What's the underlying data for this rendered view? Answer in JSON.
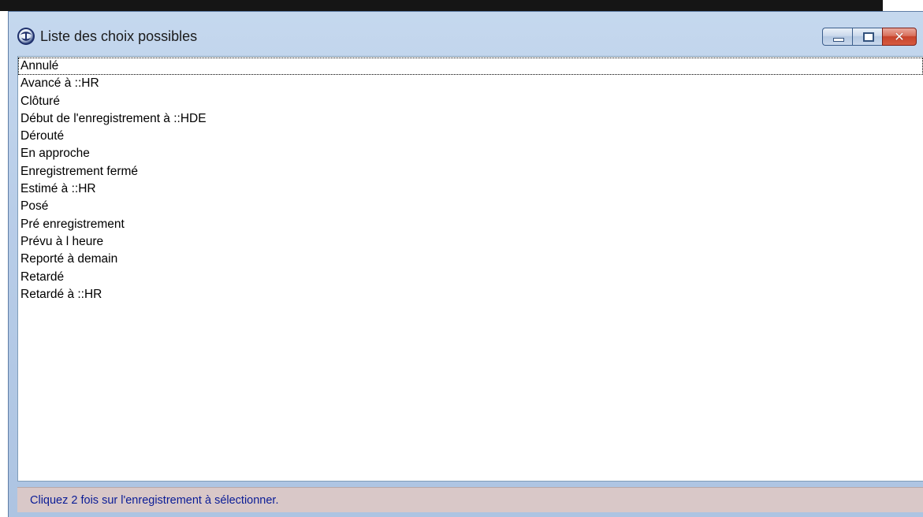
{
  "window": {
    "title": "Liste des choix possibles",
    "app_icon": "app-logo-icon",
    "buttons": {
      "minimize_icon": "minimize-icon",
      "maximize_icon": "maximize-icon",
      "close_icon": "close-icon",
      "close_glyph": "✕"
    }
  },
  "list": {
    "items": [
      "Annulé",
      "Avancé à ::HR",
      "Clôturé",
      "Début de l'enregistrement à ::HDE",
      "Dérouté",
      "En approche",
      "Enregistrement fermé",
      "Estimé à ::HR",
      "Posé",
      "Pré enregistrement",
      "Prévu à l heure",
      "Reporté à demain",
      "Retardé",
      "Retardé à ::HR"
    ],
    "focused_index": 0
  },
  "status": {
    "text": "Cliquez 2 fois sur l'enregistrement à sélectionner."
  },
  "colors": {
    "status_text": "#0a1c96",
    "status_bg": "#d9c8c8",
    "titlebar": "#b8cde8",
    "close_button": "#c7432b"
  }
}
